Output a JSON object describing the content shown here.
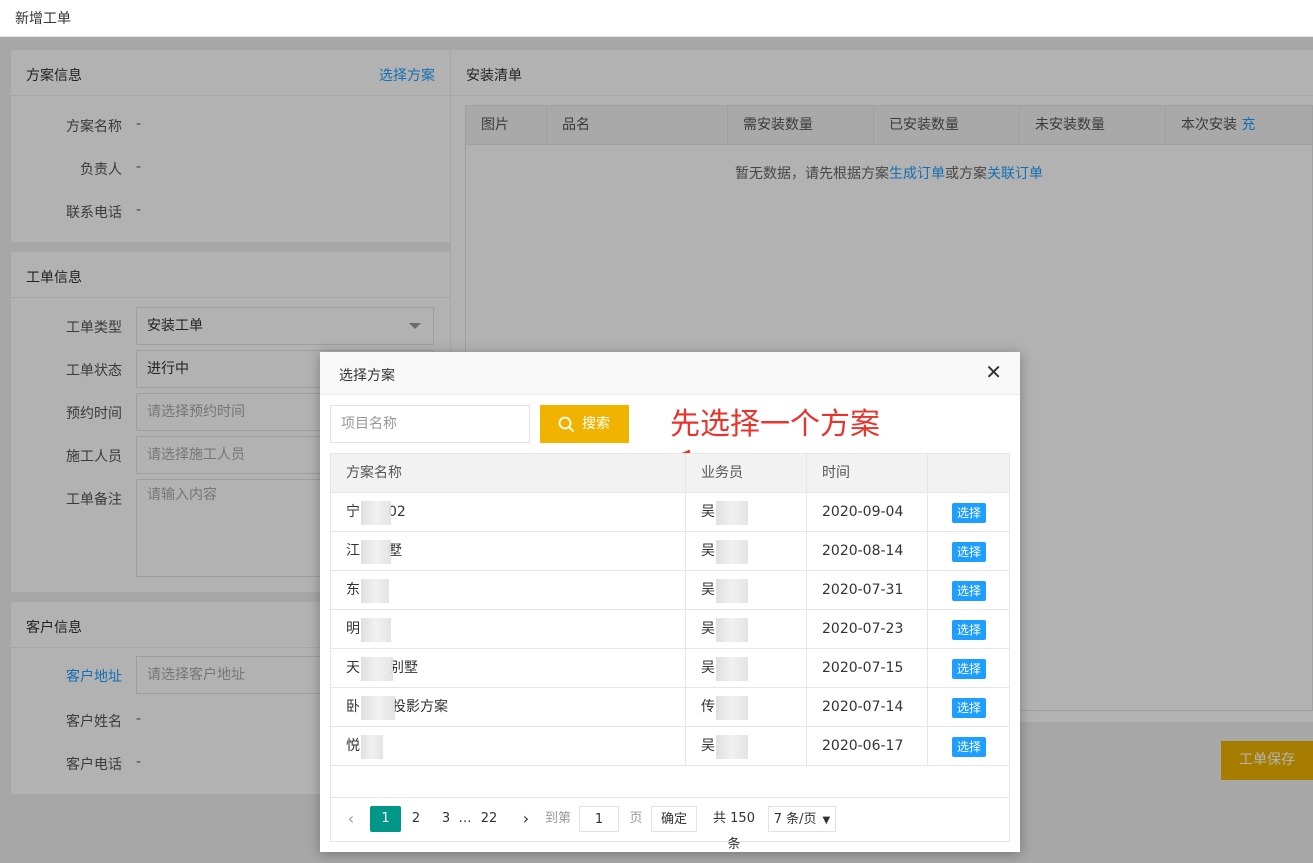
{
  "topbar": {
    "title": "新增工单"
  },
  "plan_info": {
    "header": "方案信息",
    "select_link": "选择方案",
    "fields": [
      {
        "label": "方案名称",
        "value": "-"
      },
      {
        "label": "负责人",
        "value": "-"
      },
      {
        "label": "联系电话",
        "value": "-"
      }
    ]
  },
  "order_info": {
    "header": "工单信息",
    "type_label": "工单类型",
    "type_value": "安装工单",
    "status_label": "工单状态",
    "status_value": "进行中",
    "time_label": "预约时间",
    "time_placeholder": "请选择预约时间",
    "worker_label": "施工人员",
    "worker_placeholder": "请选择施工人员",
    "note_label": "工单备注",
    "note_placeholder": "请输入内容"
  },
  "customer_info": {
    "header": "客户信息",
    "address_label": "客户地址",
    "address_placeholder": "请选择客户地址",
    "name_label": "客户姓名",
    "name_value": "-",
    "phone_label": "客户电话",
    "phone_value": "-"
  },
  "install_list": {
    "header": "安装清单",
    "columns": [
      "图片",
      "品名",
      "需安装数量",
      "已安装数量",
      "未安装数量",
      "本次安装"
    ],
    "fill_link": "充",
    "empty_prefix": "暂无数据，请先根据方案",
    "empty_link1": "生成订单",
    "empty_mid": "或方案",
    "empty_link2": "关联订单"
  },
  "save_button": "工单保存",
  "modal": {
    "title": "选择方案",
    "search_placeholder": "项目名称",
    "search_button": "搜索",
    "annotation": "先选择一个方案",
    "columns": [
      "方案名称",
      "业务员",
      "时间",
      ""
    ],
    "pick_label": "选择",
    "rows": [
      {
        "name_a": "宁",
        "name_b": "02",
        "person": "吴",
        "date": "2020-09-04"
      },
      {
        "name_a": "江",
        "name_b": "墅",
        "person": "吴",
        "date": "2020-08-14"
      },
      {
        "name_a": "东",
        "name_b": "",
        "person": "吴",
        "date": "2020-07-31"
      },
      {
        "name_a": "明",
        "name_b": "",
        "person": "吴",
        "date": "2020-07-23"
      },
      {
        "name_a": "天",
        "name_b": "别墅",
        "person": "吴",
        "date": "2020-07-15"
      },
      {
        "name_a": "卧",
        "name_b": "投影方案",
        "person": "传",
        "date": "2020-07-14"
      },
      {
        "name_a": "悦",
        "name_b": "",
        "person": "吴",
        "date": "2020-06-17"
      }
    ],
    "pager": {
      "pages": [
        "1",
        "2",
        "3",
        "…",
        "22"
      ],
      "goto_prefix": "到第",
      "goto_value": "1",
      "goto_suffix": "页",
      "confirm": "确定",
      "total": "共 150 条",
      "per_page": "7 条/页"
    }
  },
  "colors": {
    "accent": "#1e9fff",
    "warning": "#f0b400",
    "current_page": "#009688",
    "annotation": "#e8342c"
  }
}
